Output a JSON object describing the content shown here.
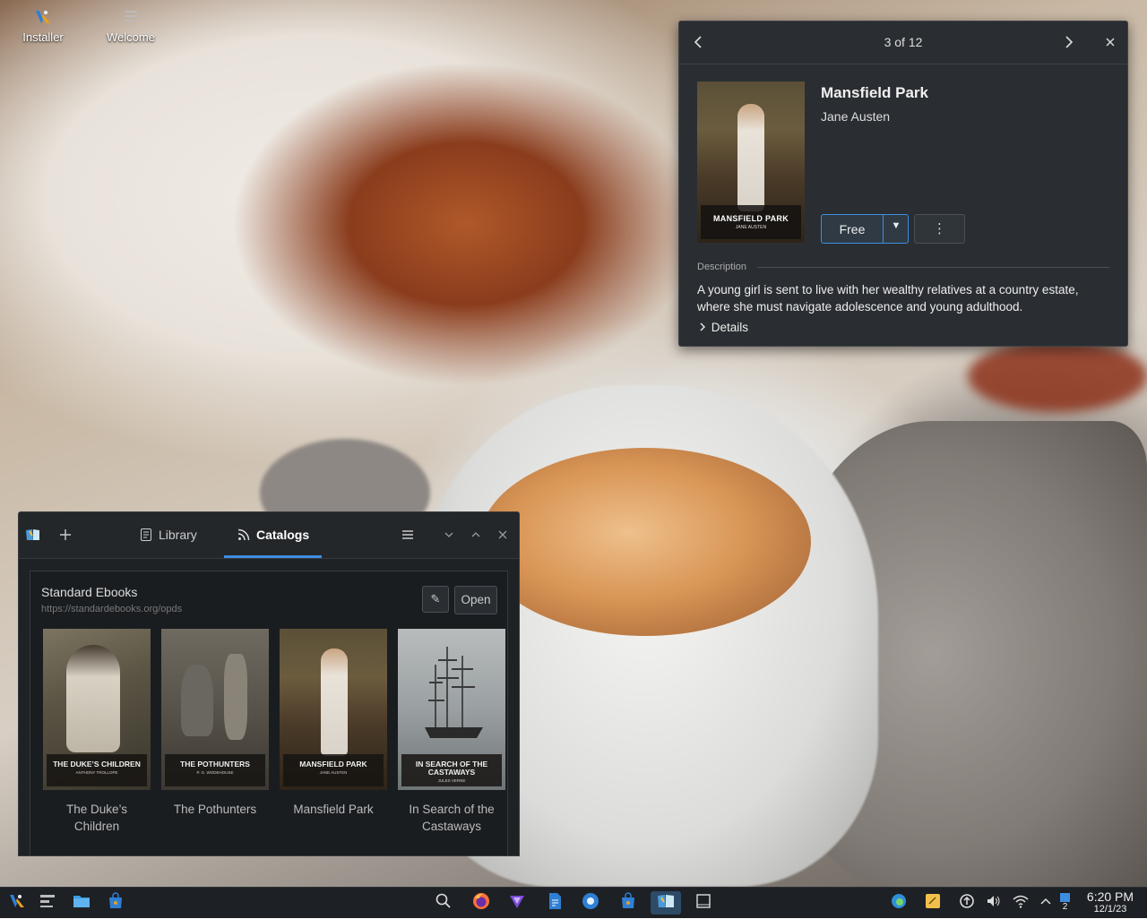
{
  "desktop": {
    "icons": [
      {
        "label": "Installer",
        "icon": "installer-icon"
      },
      {
        "label": "Welcome",
        "icon": "welcome-icon"
      }
    ]
  },
  "popup": {
    "counter": "3 of 12",
    "title": "Mansfield Park",
    "author": "Jane Austen",
    "cover_title": "MANSFIELD PARK",
    "cover_author": "JANE AUSTEN",
    "free_label": "Free",
    "description_label": "Description",
    "description": "A young girl is sent to live with her wealthy relatives at a country estate, where she must navigate adolescence and young adulthood.",
    "details_label": "Details"
  },
  "library_window": {
    "tabs": [
      {
        "label": "Library",
        "icon": "library-icon"
      },
      {
        "label": "Catalogs",
        "icon": "rss-icon",
        "active": true
      }
    ],
    "catalog": {
      "name": "Standard Ebooks",
      "url": "https://standardebooks.org/opds",
      "open_label": "Open"
    },
    "books": [
      {
        "title": "The Duke’s Children",
        "cover_title": "THE DUKE’S CHILDREN",
        "cover_author": "ANTHONY TROLLOPE"
      },
      {
        "title": "The Pothunters",
        "cover_title": "THE POTHUNTERS",
        "cover_author": "P. G. WODEHOUSE"
      },
      {
        "title": "Mansfield Park",
        "cover_title": "MANSFIELD PARK",
        "cover_author": "JANE AUSTEN"
      },
      {
        "title": "In Search of the Castaways",
        "cover_title": "IN SEARCH OF THE CASTAWAYS",
        "cover_author": "JULES VERNE"
      }
    ]
  },
  "taskbar": {
    "workspace_badge": "2",
    "time": "6:20 PM",
    "date": "12/1/23"
  },
  "colors": {
    "accent": "#3d8ee0",
    "panel_bg": "#2a2e32",
    "window_bg": "#1f2225",
    "taskbar_bg": "#1d2024"
  }
}
